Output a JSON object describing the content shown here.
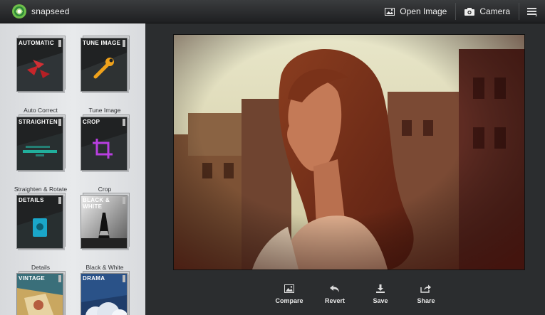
{
  "app": {
    "name": "snapseed"
  },
  "topbar": {
    "open_image_label": "Open Image",
    "camera_label": "Camera"
  },
  "tools": [
    {
      "tile_title": "AUTOMATIC",
      "label": "Auto Correct"
    },
    {
      "tile_title": "TUNE IMAGE",
      "label": "Tune Image"
    },
    {
      "tile_title": "STRAIGHTEN",
      "label": "Straighten & Rotate"
    },
    {
      "tile_title": "CROP",
      "label": "Crop"
    },
    {
      "tile_title": "DETAILS",
      "label": "Details"
    },
    {
      "tile_title": "BLACK & WHITE",
      "label": "Black & White"
    },
    {
      "tile_title": "VINTAGE",
      "label": ""
    },
    {
      "tile_title": "DRAMA",
      "label": ""
    }
  ],
  "bottom_actions": {
    "compare_label": "Compare",
    "revert_label": "Revert",
    "save_label": "Save",
    "share_label": "Share"
  }
}
